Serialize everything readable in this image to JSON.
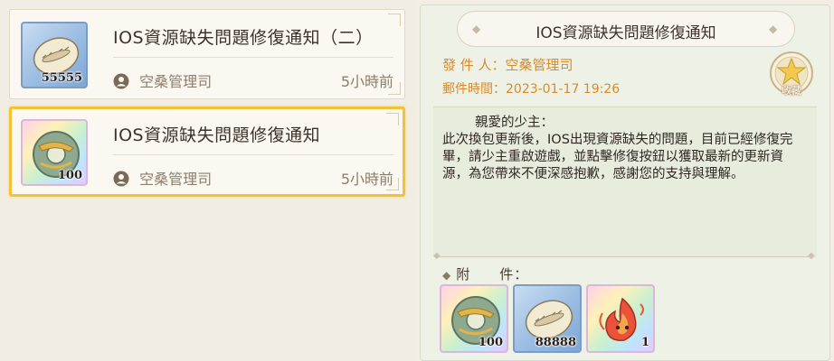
{
  "mail_list": {
    "items": [
      {
        "title": "IOS資源缺失問題修復通知（二）",
        "sender": "空桑管理司",
        "time": "5小時前",
        "icon": "shell-icon",
        "quantity": "55555",
        "selected": false
      },
      {
        "title": "IOS資源缺失問題修復通知",
        "sender": "空桑管理司",
        "time": "5小時前",
        "icon": "jade-ring-icon",
        "quantity": "100",
        "selected": true
      }
    ]
  },
  "detail": {
    "subject": "IOS資源缺失問題修復通知",
    "sender_line": "發 件 人：空桑管理司",
    "time_line": "郵件時間：2023-01-17  19:26",
    "favorite_label": "收藏",
    "body_greeting": "親愛的少主：",
    "body_text": "此次換包更新後，IOS出現資源缺失的問題，目前已經修復完畢，請少主重啟遊戲，並點擊修復按鈕以獲取最新的更新資源，為您帶來不便深感抱歉，感謝您的支持與理解。",
    "attachments_label": "附　　件：",
    "attachments": [
      {
        "icon": "jade-ring-icon",
        "quantity": "100"
      },
      {
        "icon": "shell-icon",
        "quantity": "88888"
      },
      {
        "icon": "flame-spirit-icon",
        "quantity": "1"
      }
    ]
  },
  "colors": {
    "selected_border": "#f0c23a",
    "meta_text": "#d98a2b",
    "panel_bg": "#eef2e6"
  }
}
